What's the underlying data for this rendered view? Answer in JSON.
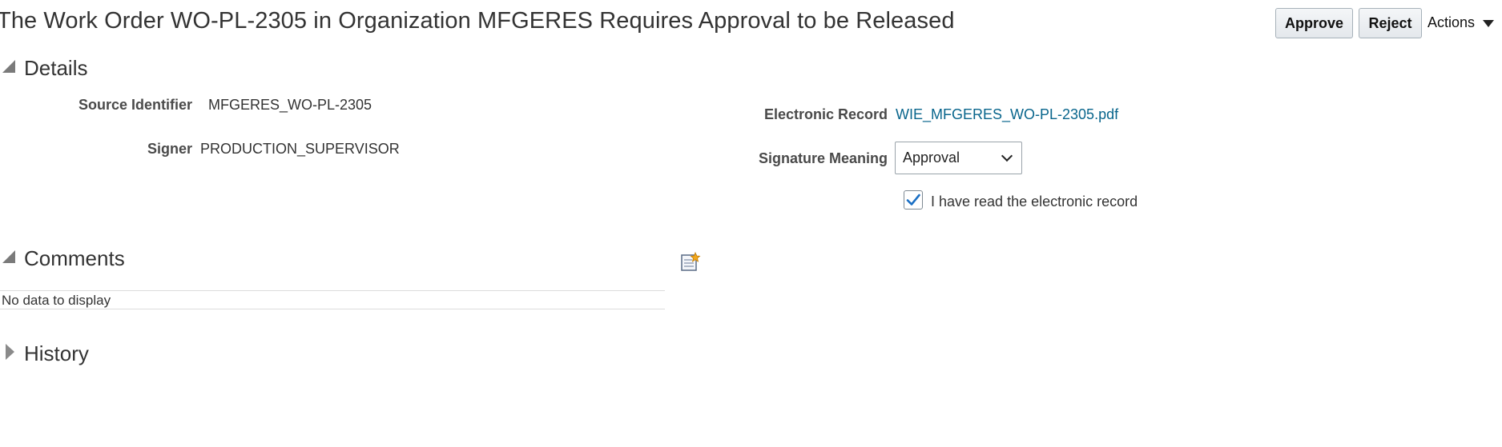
{
  "header": {
    "title": "The Work Order WO-PL-2305 in Organization MFGERES Requires Approval to be Released",
    "approve_label": "Approve",
    "reject_label": "Reject",
    "actions_label": "Actions"
  },
  "details": {
    "section_title": "Details",
    "source_identifier_label": "Source Identifier",
    "source_identifier_value": "MFGERES_WO-PL-2305",
    "signer_label": "Signer",
    "signer_value": "PRODUCTION_SUPERVISOR",
    "electronic_record_label": "Electronic Record",
    "electronic_record_link": "WIE_MFGERES_WO-PL-2305.pdf",
    "signature_meaning_label": "Signature Meaning",
    "signature_meaning_value": "Approval",
    "read_record_label": "I have read the electronic record",
    "read_record_checked": true
  },
  "comments": {
    "section_title": "Comments",
    "empty_text": "No data to display"
  },
  "history": {
    "section_title": "History"
  },
  "colors": {
    "link": "#08658c",
    "checkmark": "#1a6fc4"
  }
}
